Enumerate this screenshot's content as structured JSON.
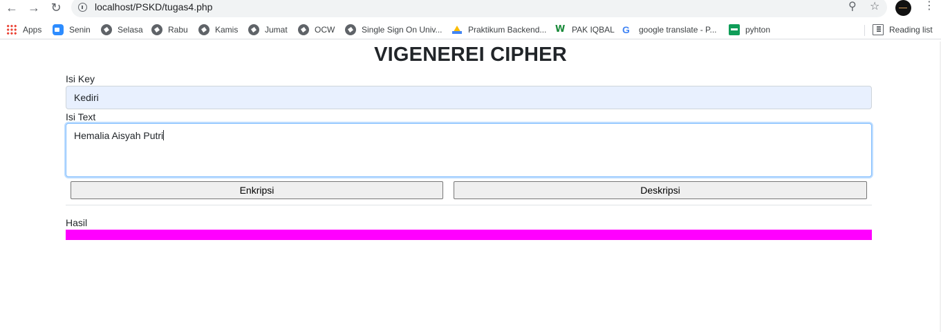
{
  "browser": {
    "url": "localhost/PSKD/tugas4.php",
    "bookmarks": [
      {
        "label": "Apps",
        "icon": "apps-grid-icon"
      },
      {
        "label": "Senin",
        "icon": "zoom-icon"
      },
      {
        "label": "Selasa",
        "icon": "globe-icon"
      },
      {
        "label": "Rabu",
        "icon": "globe-icon"
      },
      {
        "label": "Kamis",
        "icon": "globe-icon"
      },
      {
        "label": "Jumat",
        "icon": "globe-icon"
      },
      {
        "label": "OCW",
        "icon": "globe-icon"
      },
      {
        "label": "Single Sign On Univ...",
        "icon": "globe-icon"
      },
      {
        "label": "Praktikum Backend...",
        "icon": "google-drive-icon"
      },
      {
        "label": "PAK IQBAL",
        "icon": "w-icon"
      },
      {
        "label": "google translate - P...",
        "icon": "google-icon"
      },
      {
        "label": "pyhton",
        "icon": "sheets-icon"
      }
    ],
    "reading_list": "Reading list"
  },
  "page": {
    "title": "VIGENEREI CIPHER",
    "key_label": "Isi Key",
    "key_value": "Kediri",
    "text_label": "Isi Text",
    "text_value": "Hemalia Aisyah Putri",
    "encrypt_button": "Enkripsi",
    "decrypt_button": "Deskripsi",
    "result_label": "Hasil",
    "result_color": "#ff00ff"
  }
}
